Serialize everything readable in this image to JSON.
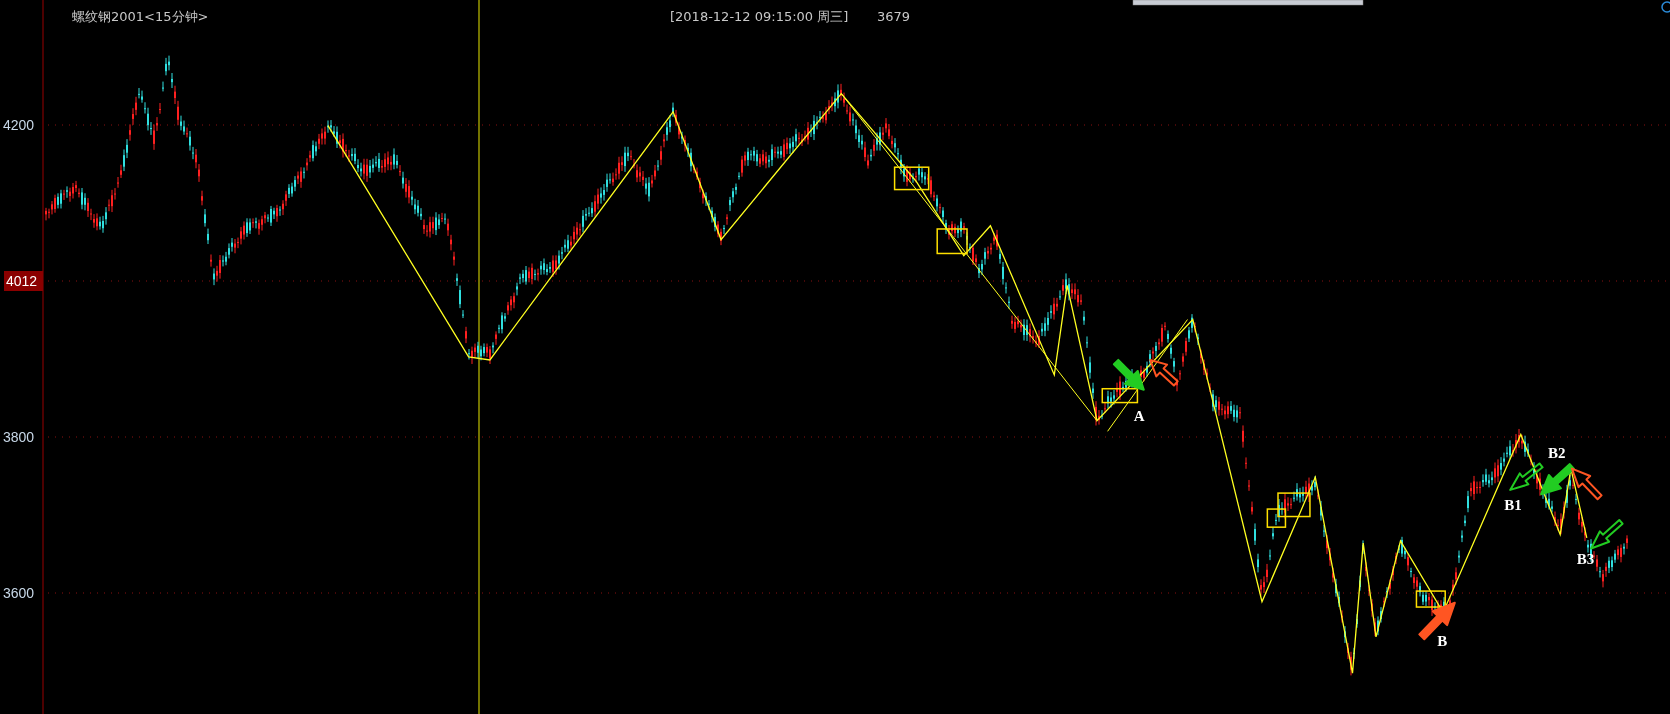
{
  "chart": {
    "title": "螺纹钢2001<15分钟>",
    "cursor_info": "[2018-12-12  09:15:00 周三]",
    "cursor_price": "3679",
    "price_axis": [
      {
        "label": "4200",
        "current": false
      },
      {
        "label": "4012",
        "current": true
      },
      {
        "label": "3800",
        "current": false
      },
      {
        "label": "3600",
        "current": false
      }
    ],
    "markers": [
      "A",
      "B",
      "B1",
      "B2",
      "B3"
    ]
  }
}
